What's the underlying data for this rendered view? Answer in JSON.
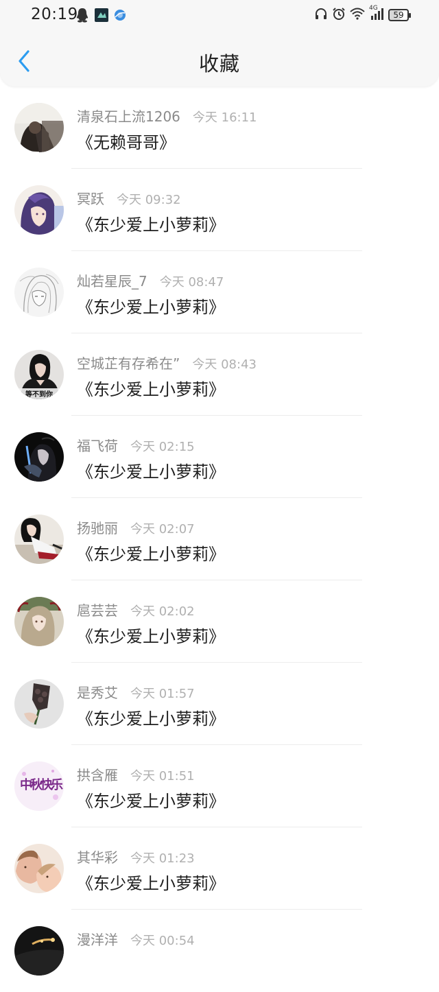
{
  "status_bar": {
    "time": "20:19",
    "network": "4G",
    "battery": "59"
  },
  "header": {
    "title": "收藏"
  },
  "colors": {
    "accent": "#2c9cf0",
    "username": "#8a8a8a",
    "timestamp": "#b0b0b0",
    "book_title": "#1e1e1e"
  },
  "favorites": [
    {
      "user": "清泉石上流1206",
      "time": "今天 16:11",
      "book": "《无赖哥哥》"
    },
    {
      "user": "冥跃",
      "time": "今天 09:32",
      "book": "《东少爱上小萝莉》"
    },
    {
      "user": "灿若星辰_7",
      "time": "今天 08:47",
      "book": "《东少爱上小萝莉》"
    },
    {
      "user": "空城芷有存希在”",
      "time": "今天 08:43",
      "book": "《东少爱上小萝莉》"
    },
    {
      "user": "福飞荷",
      "time": "今天 02:15",
      "book": "《东少爱上小萝莉》"
    },
    {
      "user": "扬驰丽",
      "time": "今天 02:07",
      "book": "《东少爱上小萝莉》"
    },
    {
      "user": "扈芸芸",
      "time": "今天 02:02",
      "book": "《东少爱上小萝莉》"
    },
    {
      "user": "是秀艾",
      "time": "今天 01:57",
      "book": "《东少爱上小萝莉》"
    },
    {
      "user": "拱含雁",
      "time": "今天 01:51",
      "book": "《东少爱上小萝莉》"
    },
    {
      "user": "其华彩",
      "time": "今天 01:23",
      "book": "《东少爱上小萝莉》"
    },
    {
      "user": "漫洋洋",
      "time": "今天 00:54",
      "book": ""
    }
  ],
  "avatar_overlays": {
    "row4": "等不到你",
    "row9": "中秋快乐"
  }
}
